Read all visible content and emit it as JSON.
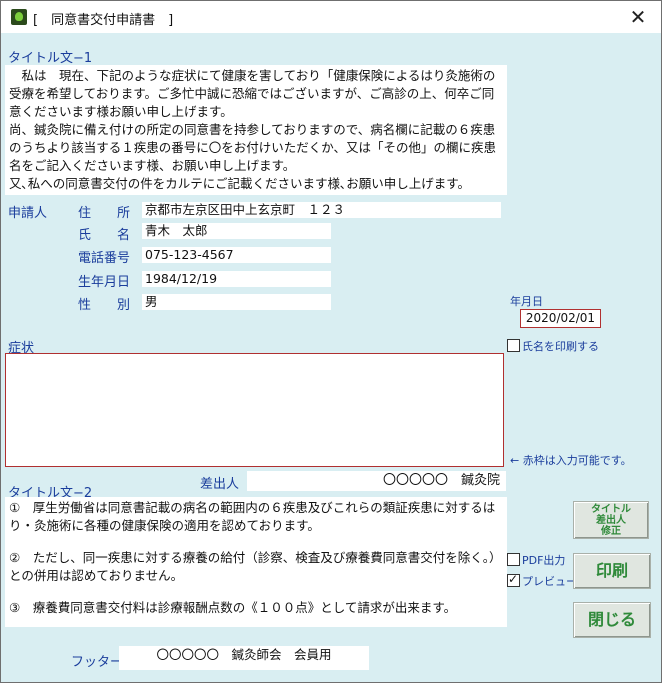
{
  "window": {
    "title": "[　同意書交付申請書　]",
    "close": "✕"
  },
  "section1": {
    "heading": "タイトル文−1",
    "paragraphs": [
      "　私は　現在、下記のような症状にて健康を害しており「健康保険によるはり灸施術の受療を希望しております。ご多忙中誠に恐縮ではございますが、ご高診の上、何卒ご同意くださいます様お願い申し上げます。",
      "尚、鍼灸院に備え付けの所定の同意書を持参しておりますので、病名欄に記載の６疾患のうちより該当する１疾患の番号に〇をお付けいただくか、又は「その他」の欄に疾患名をご記入くださいます様、お願い申し上げます。",
      "又､私への同意書交付の件をカルテにご記載くださいます様､お願い申し上げます。"
    ]
  },
  "applicant": {
    "label": "申請人",
    "address_label": "住　　所",
    "address": "京都市左京区田中上玄京町　１２３",
    "name_label": "氏　　名",
    "name": "青木　太郎",
    "phone_label": "電話番号",
    "phone": "075-123-4567",
    "birth_label": "生年月日",
    "birth": "1984/12/19",
    "gender_label": "性　　別",
    "gender": "男"
  },
  "date": {
    "label": "年月日",
    "value": "2020/02/01"
  },
  "print_name": {
    "label": "氏名を印刷する",
    "checked": false
  },
  "symptoms": {
    "label": "症状",
    "value": ""
  },
  "hint": "← 赤枠は入力可能です。",
  "sender": {
    "label": "差出人",
    "value": "〇〇〇〇〇　鍼灸院"
  },
  "section2": {
    "heading": "タイトル文−2",
    "items": [
      "①　厚生労働省は同意書記載の病名の範囲内の６疾患及びこれらの類証疾患に対するはり・灸施術に各種の健康保険の適用を認めております。",
      "②　ただし、同一疾患に対する療養の給付（診察、検査及び療養費同意書交付を除く。）との併用は認めておりません。",
      "③　療養費同意書交付料は診療報酬点数の《１００点》として請求が出来ます。"
    ]
  },
  "footer": {
    "label": "フッター",
    "value": "〇〇〇〇〇　鍼灸師会　会員用"
  },
  "buttons": {
    "title_edit_lines": [
      "タイトル",
      "差出人",
      "修正"
    ],
    "print": "印刷",
    "close": "閉じる"
  },
  "options": {
    "pdf_label": "PDF出力",
    "pdf_checked": false,
    "preview_label": "プレビュー",
    "preview_checked": true
  },
  "colors": {
    "window_bg": "#d9eef2",
    "label": "#1a3d9c",
    "button_text": "#2f8a3a",
    "input_border": "#b03030"
  }
}
